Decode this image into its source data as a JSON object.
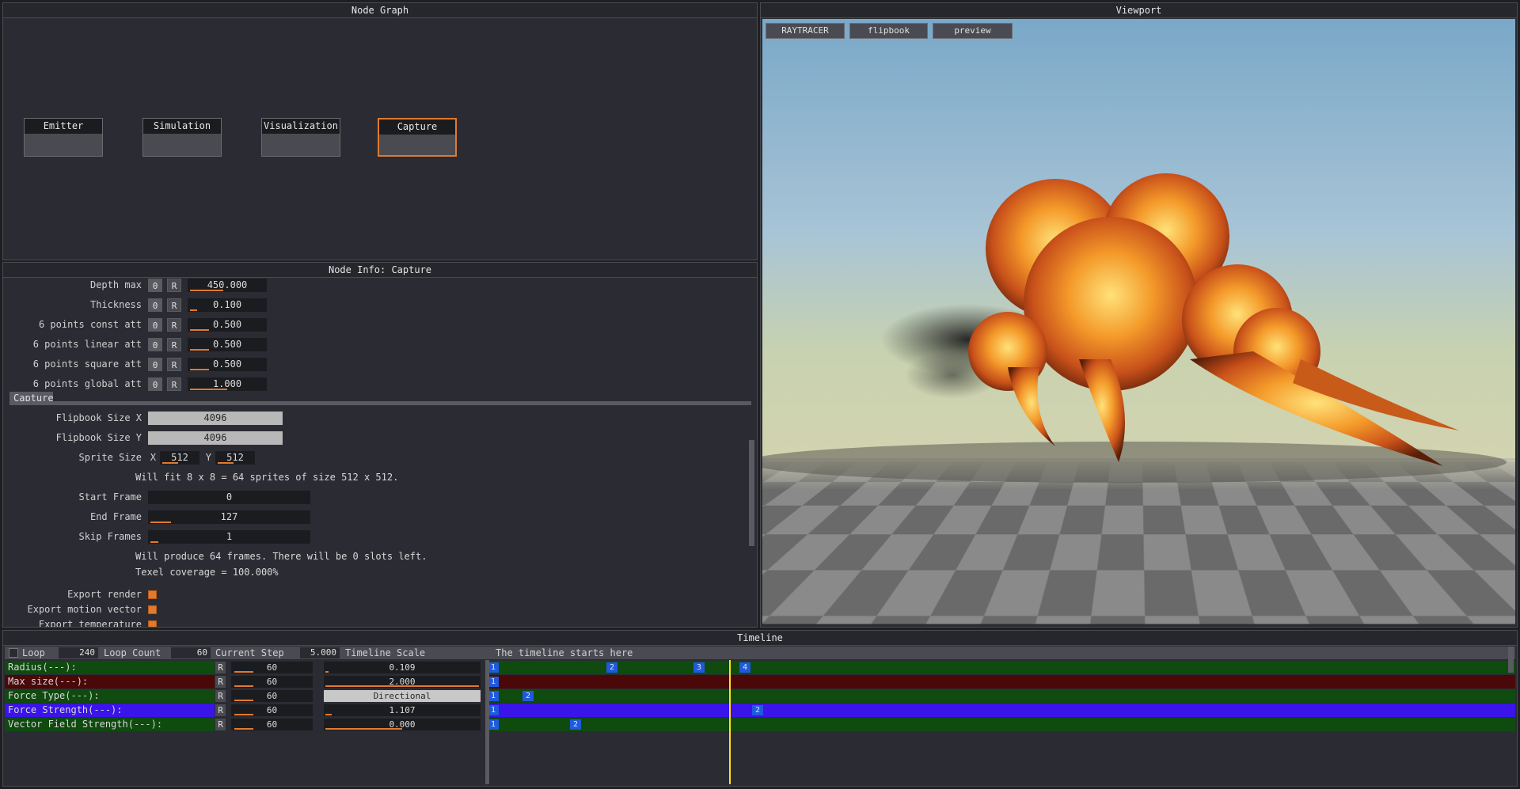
{
  "node_graph": {
    "title": "Node Graph",
    "nodes": [
      {
        "label": "Emitter"
      },
      {
        "label": "Simulation"
      },
      {
        "label": "Visualization"
      },
      {
        "label": "Capture",
        "selected": true
      }
    ]
  },
  "node_info": {
    "title": "Node Info: Capture",
    "params": [
      {
        "label": "Depth max",
        "value": "450.000",
        "fill": 0.45
      },
      {
        "label": "Thickness",
        "value": "0.100",
        "fill": 0.1
      },
      {
        "label": "6 points const att",
        "value": "0.500",
        "fill": 0.25
      },
      {
        "label": "6 points linear att",
        "value": "0.500",
        "fill": 0.25
      },
      {
        "label": "6 points square att",
        "value": "0.500",
        "fill": 0.25
      },
      {
        "label": "6 points global att",
        "value": "1.000",
        "fill": 0.5
      }
    ],
    "zero_btn": "0",
    "reset_btn": "R",
    "section": "Capture",
    "flipbook_x_label": "Flipbook Size X",
    "flipbook_x": "4096",
    "flipbook_y_label": "Flipbook Size Y",
    "flipbook_y": "4096",
    "sprite_label": "Sprite Size",
    "sprite_x_label": "X",
    "sprite_x": "512",
    "sprite_y_label": "Y",
    "sprite_y": "512",
    "fit_text": "Will fit 8 x 8 = 64 sprites of size 512 x 512.",
    "start_label": "Start Frame",
    "start_value": "0",
    "end_label": "End Frame",
    "end_value": "127",
    "skip_label": "Skip Frames",
    "skip_value": "1",
    "produce_text": "Will produce 64 frames. There will be 0 slots left.",
    "texel_text": "Texel coverage = 100.000%",
    "export_render": "Export render",
    "export_motion": "Export motion vector",
    "export_temp": "Export temperature"
  },
  "viewport": {
    "title": "Viewport",
    "buttons": [
      "RAYTRACER",
      "flipbook",
      "preview"
    ]
  },
  "timeline": {
    "title": "Timeline",
    "loop_label": "Loop",
    "loop_value": "240",
    "loop_count_label": "Loop Count",
    "loop_count_value": "60",
    "current_step_label": "Current Step",
    "current_step_value": "5.000",
    "timeline_scale_label": "Timeline Scale",
    "starts_text": "The timeline starts here",
    "rows": [
      {
        "name": "Radius(---):",
        "count": "60",
        "value": "0.109",
        "value_fill": 0.02,
        "color": "#0f4a0f",
        "keys": [
          {
            "label": "1",
            "pos": 0
          },
          {
            "label": "2",
            "pos": 150
          },
          {
            "label": "3",
            "pos": 260
          },
          {
            "label": "4",
            "pos": 318
          }
        ]
      },
      {
        "name": "Max size(---):",
        "count": "60",
        "value": "2.000",
        "value_fill": 1.0,
        "color": "#4a0808",
        "keys": [
          {
            "label": "1",
            "pos": 0
          }
        ]
      },
      {
        "name": "Force Type(---):",
        "count": "60",
        "value": "Directional",
        "value_fill": 0,
        "color": "#0f4a0f",
        "light": true,
        "keys": [
          {
            "label": "1",
            "pos": 0
          },
          {
            "label": "2",
            "pos": 44
          }
        ]
      },
      {
        "name": "Force Strength(---):",
        "count": "60",
        "value": "1.107",
        "value_fill": 0.04,
        "color": "#3a14e8",
        "keys": [
          {
            "label": "1",
            "pos": 0
          },
          {
            "label": "2",
            "pos": 334
          }
        ]
      },
      {
        "name": "Vector Field Strength(---):",
        "count": "60",
        "value": "0.000",
        "value_fill": 0.5,
        "color": "#0f4a0f",
        "keys": [
          {
            "label": "1",
            "pos": 0
          },
          {
            "label": "2",
            "pos": 104
          }
        ]
      }
    ],
    "reset_btn": "R"
  }
}
